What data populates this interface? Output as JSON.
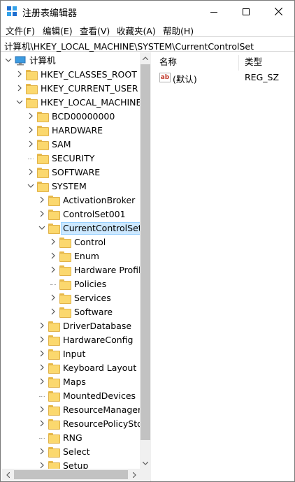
{
  "window": {
    "title": "注册表编辑器",
    "icon": "regedit-icon",
    "controls": {
      "minimize": "minimize-icon",
      "maximize": "maximize-icon",
      "close": "close-icon"
    }
  },
  "menu": [
    "文件(F)",
    "编辑(E)",
    "查看(V)",
    "收藏夹(A)",
    "帮助(H)"
  ],
  "address": "计算机\\HKEY_LOCAL_MACHINE\\SYSTEM\\CurrentControlSet",
  "tree": {
    "root": "计算机",
    "hives": [
      "HKEY_CLASSES_ROOT",
      "HKEY_CURRENT_USER",
      "HKEY_LOCAL_MACHINE"
    ],
    "hklm_children": [
      "BCD00000000",
      "HARDWARE",
      "SAM",
      "SECURITY",
      "SOFTWARE",
      "SYSTEM"
    ],
    "system_children_top": [
      "ActivationBroker",
      "ControlSet001",
      "CurrentControlSet"
    ],
    "ccs_children": [
      "Control",
      "Enum",
      "Hardware Profil",
      "Policies",
      "Services",
      "Software"
    ],
    "system_children_bottom": [
      "DriverDatabase",
      "HardwareConfig",
      "Input",
      "Keyboard Layout",
      "Maps",
      "MountedDevices",
      "ResourceManager",
      "ResourcePolicySto",
      "RNG",
      "Select",
      "Setup"
    ],
    "selected": "CurrentControlSet"
  },
  "list": {
    "headers": {
      "name": "名称",
      "type": "类型"
    },
    "rows": [
      {
        "name": "(默认)",
        "type": "REG_SZ",
        "icon": "string-value-icon",
        "icon_text": "ab"
      }
    ]
  },
  "colors": {
    "selection_bg": "#cce8ff",
    "selection_border": "#99d1ff",
    "folder": "#fbd86e",
    "scrollbar_thumb": "#c2c2c2"
  }
}
